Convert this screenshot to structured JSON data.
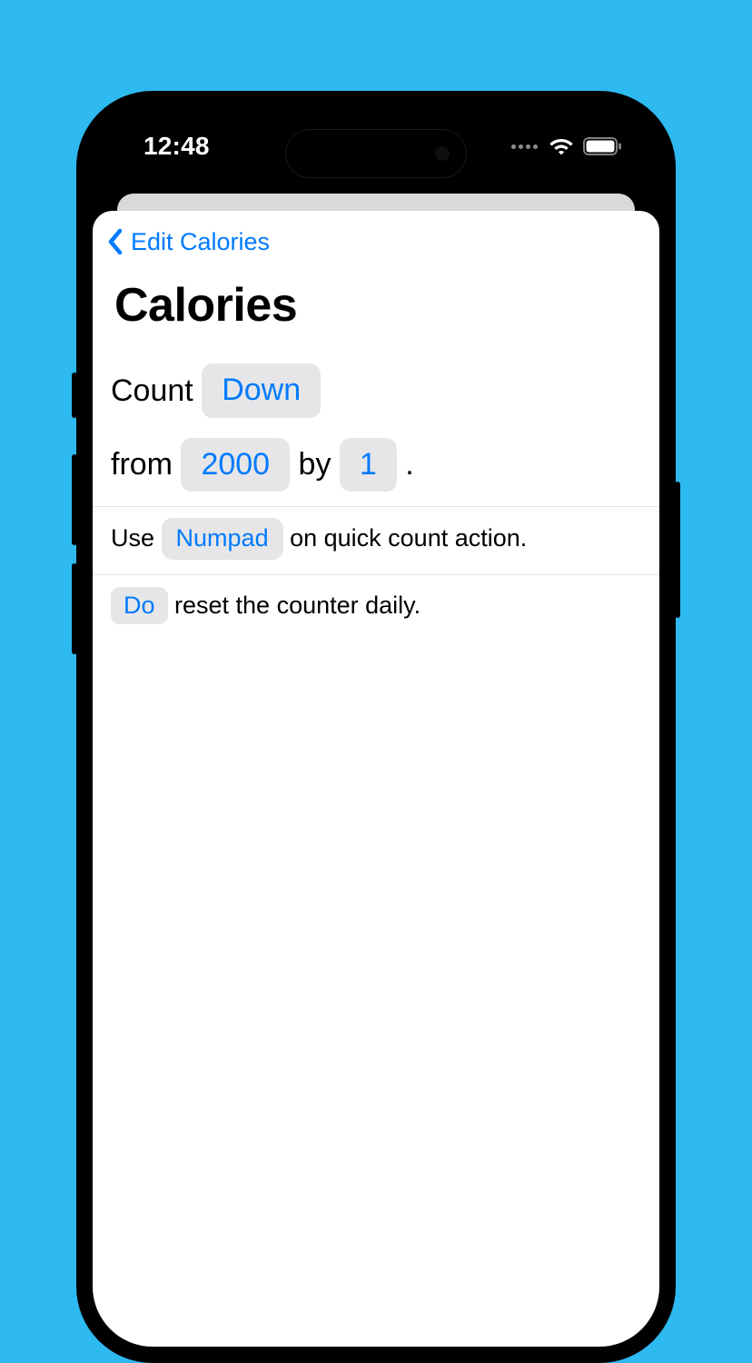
{
  "status": {
    "time": "12:48"
  },
  "nav": {
    "back_label": "Edit Calories"
  },
  "page": {
    "title": "Calories"
  },
  "row1": {
    "label_count": "Count ",
    "direction": "Down",
    "label_from": "from ",
    "start_value": "2000",
    "label_by": " by ",
    "step_value": "1",
    "label_period": " ."
  },
  "row2": {
    "label_use": "Use ",
    "keyboard": "Numpad",
    "label_suffix": " on quick count action."
  },
  "row3": {
    "reset_choice": "Do",
    "label_suffix": " reset the counter daily."
  }
}
